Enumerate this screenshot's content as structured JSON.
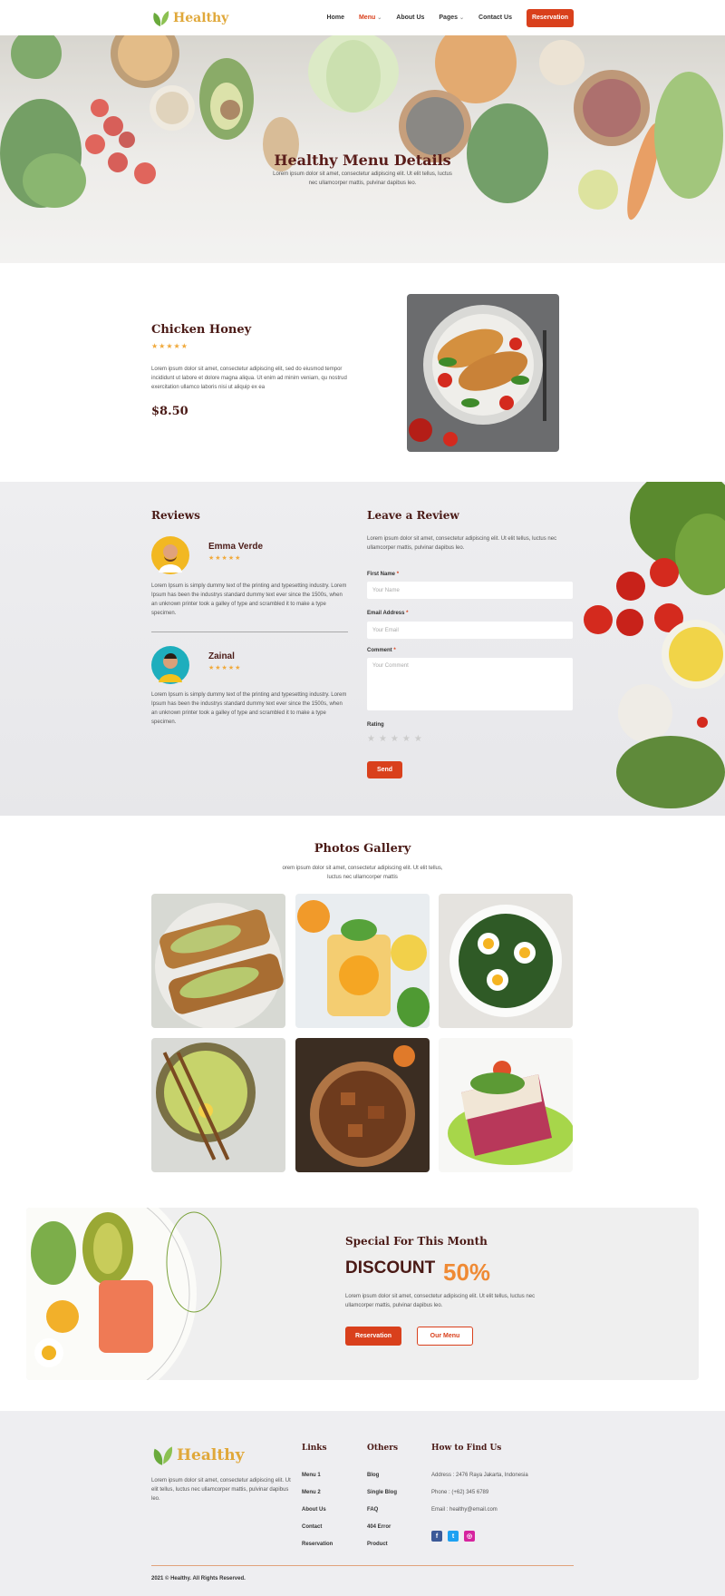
{
  "header": {
    "logo_text": "Healthy",
    "nav": [
      {
        "label": "Home"
      },
      {
        "label": "Menu"
      },
      {
        "label": "About Us"
      },
      {
        "label": "Pages"
      },
      {
        "label": "Contact Us"
      }
    ],
    "cta": "Reservation"
  },
  "hero": {
    "title": "Healthy Menu Details",
    "subtitle": "Lorem ipsum dolor sit amet, consectetur adipiscing elit. Ut elit tellus, luctus nec ullamcorper mattis, pulvinar dapibus leo."
  },
  "product": {
    "name": "Chicken Honey",
    "rating": 4.5,
    "stars": "★★★★★",
    "description": "Lorem ipsum dolor sit amet, consectetur adipiscing elit, sed do eiusmod tempor incididunt ut labore et dolore magna aliqua. Ut enim ad minim veniam, qu nostrud exercitation ullamco laboris nisi ut aliquip ex ea",
    "price": "$8.50"
  },
  "reviews": {
    "title": "Reviews",
    "items": [
      {
        "name": "Emma Verde",
        "stars": "★★★★★",
        "text": "Lorem Ipsum is simply dummy text of the printing and typesetting industry. Lorem Ipsum has been the industrys standard dummy text ever since the 1500s, when an unknown printer took a galley of type and scrambled it to make a type specimen."
      },
      {
        "name": "Zainal",
        "stars": "★★★★★",
        "text": "Lorem Ipsum is simply dummy text of the printing and typesetting industry. Lorem Ipsum has been the industrys standard dummy text ever since the 1500s, when an unknown printer took a galley of type and scrambled it to make a type specimen."
      }
    ]
  },
  "review_form": {
    "title": "Leave a Review",
    "intro": "Lorem ipsum dolor sit amet, consectetur adipiscing elit. Ut elit tellus, luctus nec ullamcorper mattis, pulvinar dapibus leo.",
    "first_name_label": "First Name",
    "first_name_placeholder": "Your Name",
    "email_label": "Email Address",
    "email_placeholder": "Your Email",
    "comment_label": "Comment",
    "comment_placeholder": "Your Comment",
    "rating_label": "Rating",
    "rating_stars": "★★★★★",
    "send": "Send",
    "required_mark": "*"
  },
  "gallery": {
    "title": "Photos Gallery",
    "subtitle": "orem ipsum dolor sit amet, consectetur adipiscing elit. Ut elit tellus, luctus nec ullamcorper mattis"
  },
  "special": {
    "title": "Special For This Month",
    "discount_word": "DISCOUNT",
    "discount_value": "50%",
    "text": "Lorem ipsum dolor sit amet, consectetur adipiscing elit. Ut elit tellus, luctus nec ullamcorper mattis, pulvinar dapibus leo.",
    "btn_reservation": "Reservation",
    "btn_menu": "Our Menu"
  },
  "footer": {
    "logo_text": "Healthy",
    "about": "Lorem ipsum dolor sit amet, consectetur adipiscing elit. Ut elit tellus, luctus nec ullamcorper mattis, pulvinar dapibus leo.",
    "links_title": "Links",
    "links": [
      "Menu 1",
      "Menu 2",
      "About Us",
      "Contact",
      "Reservation"
    ],
    "others_title": "Others",
    "others": [
      "Blog",
      "Single Blog",
      "FAQ",
      "404 Error",
      "Product"
    ],
    "find_title": "How to Find Us",
    "address": "Address : 2476 Raya Jakarta, Indonesia",
    "phone": "Phone : (+62) 345 6789",
    "email": "Email : healthy@email.com",
    "copyright": "2021 © Healthy. All Rights Reserved."
  },
  "colors": {
    "accent": "#d9401c",
    "brand": "#e0a83a",
    "heading": "#4a1a16"
  }
}
